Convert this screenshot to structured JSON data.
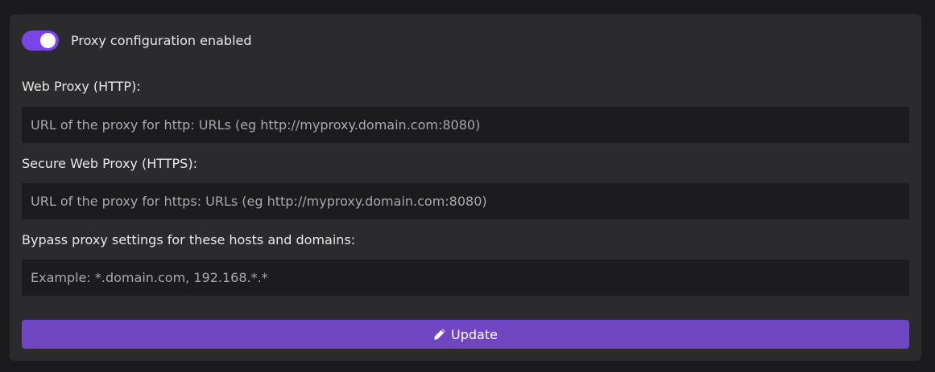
{
  "proxy_toggle": {
    "label": "Proxy configuration enabled",
    "enabled": true,
    "accent_color": "#7b44e6"
  },
  "fields": [
    {
      "label": "Web Proxy (HTTP):",
      "value": "",
      "placeholder": "URL of the proxy for http: URLs (eg http://myproxy.domain.com:8080)"
    },
    {
      "label": "Secure Web Proxy (HTTPS):",
      "value": "",
      "placeholder": "URL of the proxy for https: URLs (eg http://myproxy.domain.com:8080)"
    },
    {
      "label": "Bypass proxy settings for these hosts and domains:",
      "value": "",
      "placeholder": "Example: *.domain.com, 192.168.*.*"
    }
  ],
  "update_button": {
    "label": "Update",
    "icon": "pencil-icon",
    "color": "#6f45c1"
  }
}
